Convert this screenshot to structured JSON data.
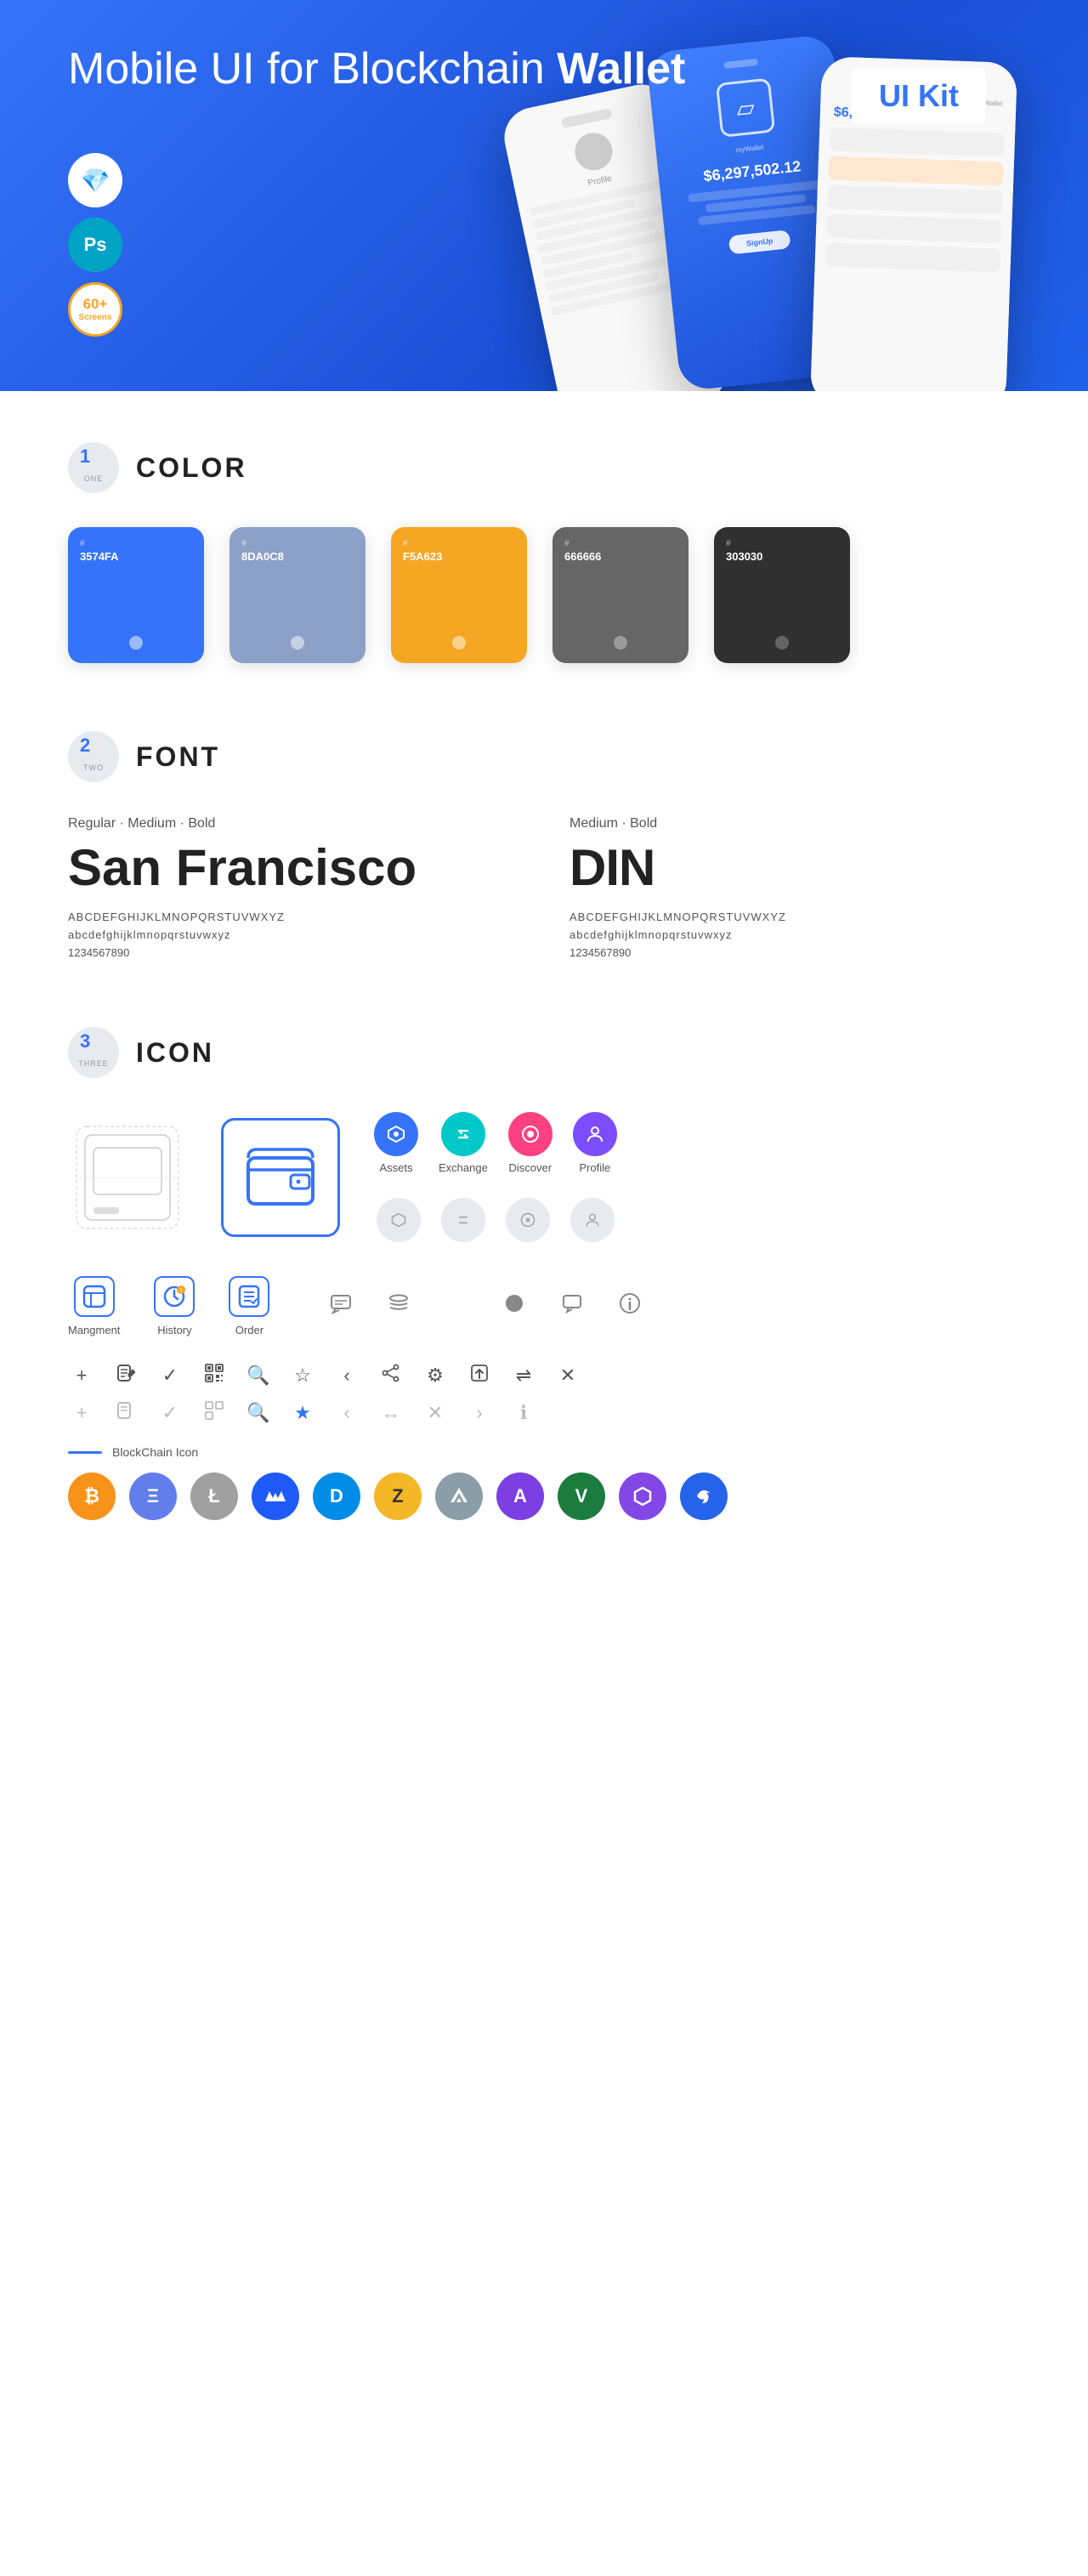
{
  "hero": {
    "title_normal": "Mobile UI for Blockchain ",
    "title_bold": "Wallet",
    "ui_kit_badge": "UI Kit",
    "badges": [
      {
        "id": "sketch",
        "label": "Sketch",
        "symbol": "💎"
      },
      {
        "id": "photoshop",
        "label": "Ps"
      },
      {
        "id": "screens",
        "count": "60+",
        "unit": "Screens"
      }
    ]
  },
  "sections": {
    "color": {
      "number": "1",
      "word": "ONE",
      "title": "COLOR",
      "swatches": [
        {
          "id": "blue",
          "hex": "#3574FA",
          "code": "3574FA",
          "bg": "#3574FA"
        },
        {
          "id": "gray-blue",
          "hex": "#8DA0C8",
          "code": "8DA0C8",
          "bg": "#8DA0C8"
        },
        {
          "id": "orange",
          "hex": "#F5A623",
          "code": "F5A623",
          "bg": "#F5A623"
        },
        {
          "id": "gray",
          "hex": "#666666",
          "code": "666666",
          "bg": "#666666"
        },
        {
          "id": "dark",
          "hex": "#303030",
          "code": "303030",
          "bg": "#303030"
        }
      ]
    },
    "font": {
      "number": "2",
      "word": "TWO",
      "title": "FONT",
      "fonts": [
        {
          "id": "sf",
          "style_label": "Regular · Medium · Bold",
          "name": "San Francisco",
          "uppercase": "ABCDEFGHIJKLMNOPQRSTUVWXYZ",
          "lowercase": "abcdefghijklmnopqrstuvwxyz",
          "numbers": "1234567890"
        },
        {
          "id": "din",
          "style_label": "Medium · Bold",
          "name": "DIN",
          "uppercase": "ABCDEFGHIJKLMNOPQRSTUVWXYZ",
          "lowercase": "abcdefghijklmnopqrstuvwxyz",
          "numbers": "1234567890"
        }
      ]
    },
    "icon": {
      "number": "3",
      "word": "THREE",
      "title": "ICON",
      "nav_icons": [
        {
          "id": "assets",
          "label": "Assets",
          "symbol": "◈"
        },
        {
          "id": "exchange",
          "label": "Exchange",
          "symbol": "⇄"
        },
        {
          "id": "discover",
          "label": "Discover",
          "symbol": "⊙"
        },
        {
          "id": "profile",
          "label": "Profile",
          "symbol": "⌀"
        }
      ],
      "bottom_icons": [
        {
          "id": "management",
          "label": "Mangment"
        },
        {
          "id": "history",
          "label": "History"
        },
        {
          "id": "order",
          "label": "Order"
        }
      ],
      "misc_icons": [
        "💬",
        "≡",
        "◑",
        "●",
        "💬",
        "ℹ"
      ],
      "blockchain_label": "BlockChain Icon",
      "crypto_coins": [
        {
          "id": "btc",
          "class": "crypto-btc",
          "symbol": "₿"
        },
        {
          "id": "eth",
          "class": "crypto-eth",
          "symbol": "Ξ"
        },
        {
          "id": "ltc",
          "class": "crypto-ltc",
          "symbol": "Ł"
        },
        {
          "id": "waves",
          "class": "crypto-waves",
          "symbol": "〜"
        },
        {
          "id": "dash",
          "class": "crypto-dash",
          "symbol": "D"
        },
        {
          "id": "zcash",
          "class": "crypto-zcash",
          "symbol": "Z"
        },
        {
          "id": "iota",
          "class": "crypto-iota",
          "symbol": "I"
        },
        {
          "id": "ardor",
          "class": "crypto-ardor",
          "symbol": "A"
        },
        {
          "id": "vert",
          "class": "crypto-vertcoin",
          "symbol": "V"
        },
        {
          "id": "polygon",
          "class": "crypto-polygon",
          "symbol": "P"
        },
        {
          "id": "extra",
          "class": "crypto-extra",
          "symbol": "~"
        }
      ]
    }
  }
}
